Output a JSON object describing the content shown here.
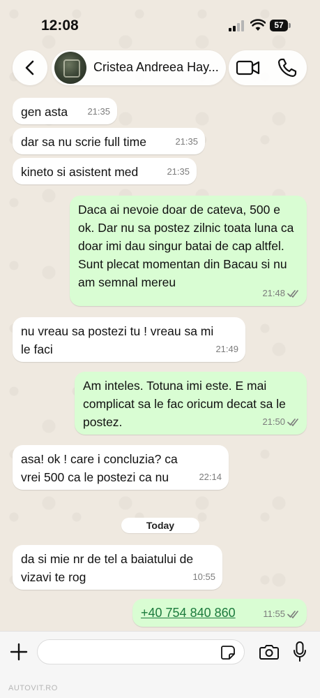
{
  "status_bar": {
    "time": "12:08",
    "battery": "57"
  },
  "header": {
    "contact_name": "Cristea Andreea Hay..."
  },
  "messages": [
    {
      "direction": "in",
      "text": "gen asta",
      "time": "21:35"
    },
    {
      "direction": "in",
      "text": "dar sa nu scrie full time",
      "time": "21:35"
    },
    {
      "direction": "in",
      "text": "kineto si asistent med",
      "time": "21:35"
    },
    {
      "direction": "out",
      "text": "Daca ai nevoie doar de cateva, 500 e ok. Dar nu sa postez zilnic toata luna ca doar imi dau singur batai de cap altfel. Sunt plecat momentan din Bacau si nu am semnal mereu",
      "time": "21:48"
    },
    {
      "direction": "in",
      "text": "nu vreau sa postezi tu ! vreau sa mi le faci",
      "time": "21:49"
    },
    {
      "direction": "out",
      "text": "Am inteles. Totuna imi este. E mai complicat sa le fac oricum decat sa le postez.",
      "time": "21:50"
    },
    {
      "direction": "in",
      "text": "asa! ok ! care i concluzia? ca vrei 500 ca le postezi ca nu",
      "time": "22:14"
    },
    {
      "direction": "in",
      "text": "da si mie nr de tel a baiatului de vizavi te rog",
      "time": "10:55"
    },
    {
      "direction": "out",
      "text": "+40 754 840 860",
      "time": "11:55"
    }
  ],
  "date_separator": "Today",
  "composer": {
    "placeholder": ""
  },
  "watermark": "AUTOVIT.RO",
  "colors": {
    "outgoing_bubble": "#d9fdd3",
    "incoming_bubble": "#ffffff",
    "wallpaper": "#efe9e0",
    "read_ticks": "#7c7c7c",
    "phone_link": "#1b7a3c"
  },
  "icons": [
    "back-chevron-icon",
    "video-call-icon",
    "phone-call-icon",
    "plus-icon",
    "sticker-icon",
    "camera-icon",
    "microphone-icon",
    "double-check-icon"
  ]
}
